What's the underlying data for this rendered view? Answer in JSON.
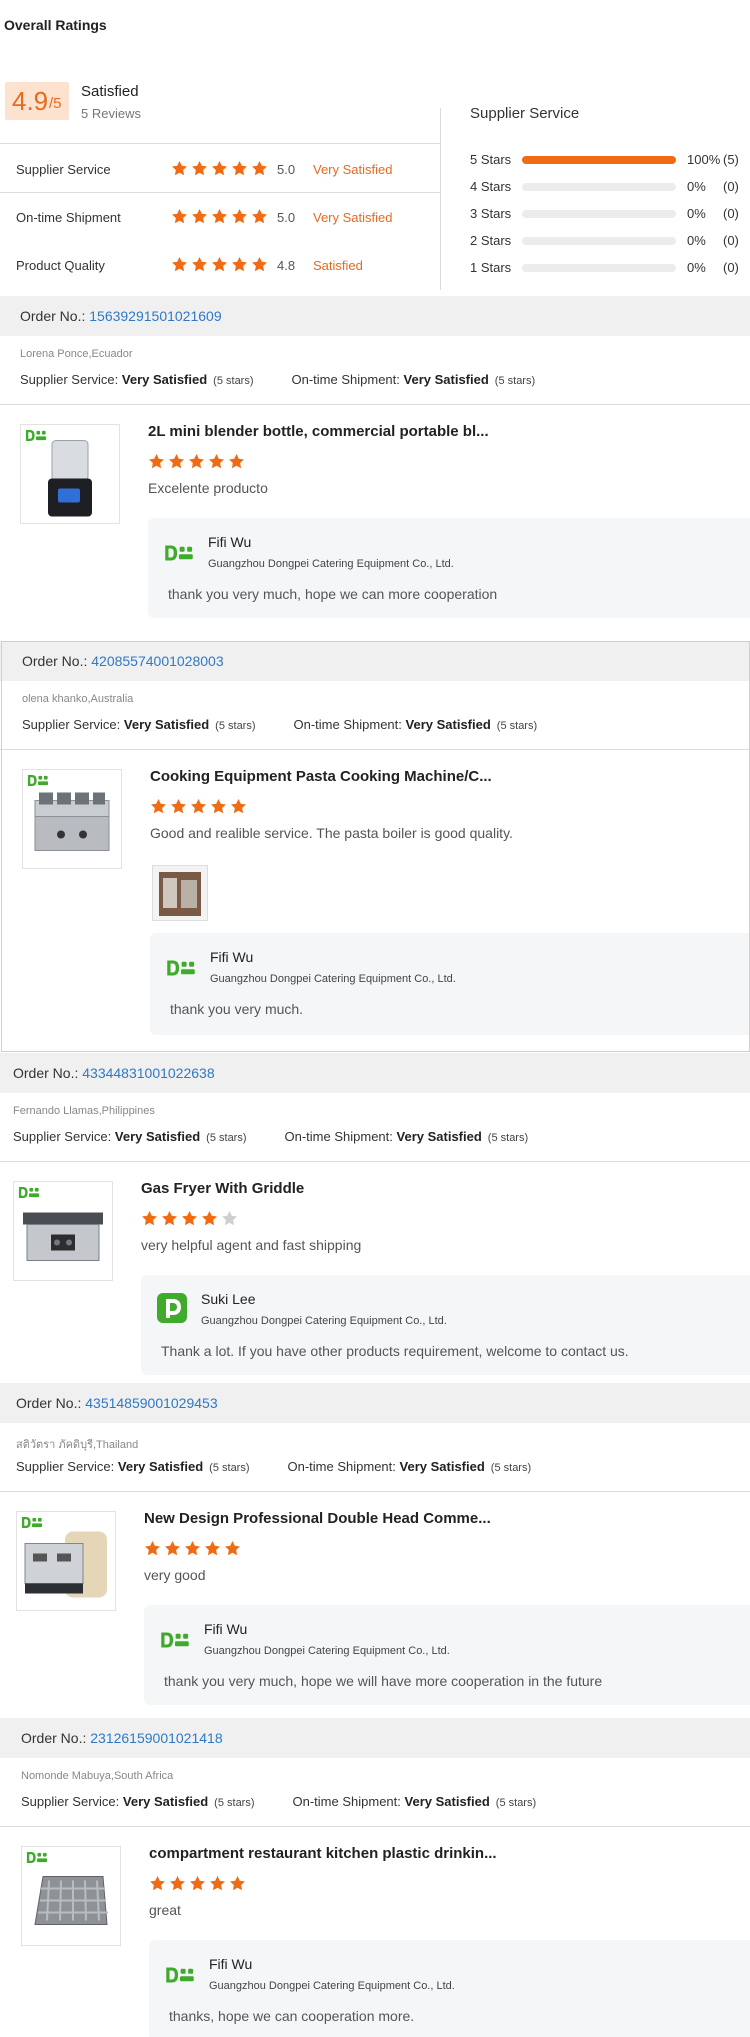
{
  "header": {
    "title": "Overall Ratings"
  },
  "summary": {
    "score": "4.9",
    "score_suffix": "/5",
    "satisfaction": "Satisfied",
    "reviews_label": "5 Reviews"
  },
  "ratings": [
    {
      "label": "Supplier Service",
      "stars": 5,
      "value": "5.0",
      "text": "Very Satisfied"
    },
    {
      "label": "On-time Shipment",
      "stars": 5,
      "value": "5.0",
      "text": "Very Satisfied"
    },
    {
      "label": "Product Quality",
      "stars": 5,
      "value": "4.8",
      "text": "Satisfied"
    }
  ],
  "distribution": {
    "title": "Supplier Service",
    "rows": [
      {
        "label": "5 Stars",
        "percent": 100,
        "pct_text": "100%",
        "count": "(5)"
      },
      {
        "label": "4 Stars",
        "percent": 0,
        "pct_text": "0%",
        "count": "(0)"
      },
      {
        "label": "3 Stars",
        "percent": 0,
        "pct_text": "0%",
        "count": "(0)"
      },
      {
        "label": "2 Stars",
        "percent": 0,
        "pct_text": "0%",
        "count": "(0)"
      },
      {
        "label": "1 Stars",
        "percent": 0,
        "pct_text": "0%",
        "count": "(0)"
      }
    ]
  },
  "labels": {
    "order_no": "Order No.: ",
    "supplier_service": "Supplier Service: ",
    "ontime_shipment": "On-time Shipment: ",
    "very_satisfied": "Very Satisfied",
    "five_stars": "(5 stars)"
  },
  "reviews": [
    {
      "order_no": "15639291501021609",
      "reviewer": "Lorena Ponce,Ecuador",
      "product_title": "2L mini blender bottle, commercial portable bl...",
      "stars": 5,
      "comment": "Excelente producto",
      "reply": {
        "name": "Fifi Wu",
        "company": "Guangzhou Dongpei Catering Equipment Co., Ltd.",
        "message": "thank you very much, hope we can more cooperation"
      }
    },
    {
      "order_no": "42085574001028003",
      "reviewer": "olena khanko,Australia",
      "product_title": "Cooking Equipment Pasta Cooking Machine/C...",
      "stars": 5,
      "comment": "Good and realible service. The pasta boiler is good quality.",
      "reply": {
        "name": "Fifi Wu",
        "company": "Guangzhou Dongpei Catering Equipment Co., Ltd.",
        "message": "thank you very much."
      }
    },
    {
      "order_no": "43344831001022638",
      "reviewer": "Fernando Llamas,Philippines",
      "product_title": "Gas Fryer With Griddle",
      "stars": 4,
      "comment": "very helpful agent and fast shipping",
      "reply": {
        "name": "Suki Lee",
        "company": "Guangzhou Dongpei Catering Equipment Co., Ltd.",
        "message": "Thank a lot. If you have other products requirement, welcome to contact us."
      }
    },
    {
      "order_no": "43514859001029453",
      "reviewer": "สติวัตรา ภัคดิบุรี,Thailand",
      "product_title": "New Design Professional Double Head Comme...",
      "stars": 5,
      "comment": "very good",
      "reply": {
        "name": "Fifi Wu",
        "company": "Guangzhou Dongpei Catering Equipment Co., Ltd.",
        "message": "thank you very much,  hope we will have more cooperation in the future"
      }
    },
    {
      "order_no": "23126159001021418",
      "reviewer": "Nomonde Mabuya,South Africa",
      "product_title": "compartment restaurant kitchen plastic drinkin...",
      "stars": 5,
      "comment": "great",
      "reply": {
        "name": "Fifi Wu",
        "company": "Guangzhou Dongpei Catering Equipment Co., Ltd.",
        "message": "thanks, hope we can cooperation more."
      }
    }
  ],
  "colors": {
    "accent": "#ef6c14",
    "link": "#2f79c6",
    "logo_green": "#3faa2b"
  }
}
